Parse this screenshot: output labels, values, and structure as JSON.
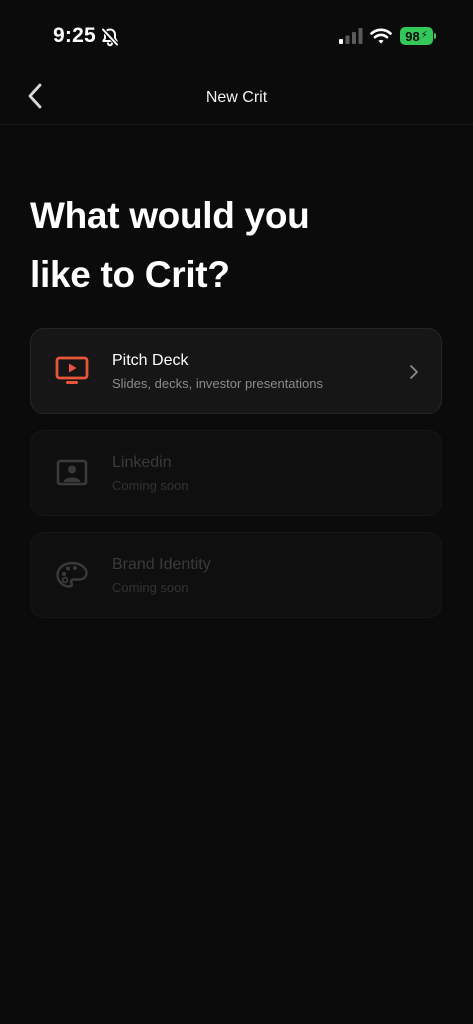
{
  "status_bar": {
    "time": "9:25",
    "battery": "98",
    "battery_color": "#34c759"
  },
  "nav": {
    "title": "New Crit",
    "back_icon": "chevron-left-icon"
  },
  "heading": {
    "line1": "What would you",
    "line2": "like to Crit?"
  },
  "options": [
    {
      "title": "Pitch Deck",
      "subtitle": "Slides, decks, investor presentations",
      "icon": "presentation-icon",
      "icon_color": "#e8553a",
      "enabled": true
    },
    {
      "title": "Linkedin",
      "subtitle": "Coming soon",
      "icon": "profile-card-icon",
      "enabled": false
    },
    {
      "title": "Brand Identity",
      "subtitle": "Coming soon",
      "icon": "palette-icon",
      "enabled": false
    }
  ]
}
